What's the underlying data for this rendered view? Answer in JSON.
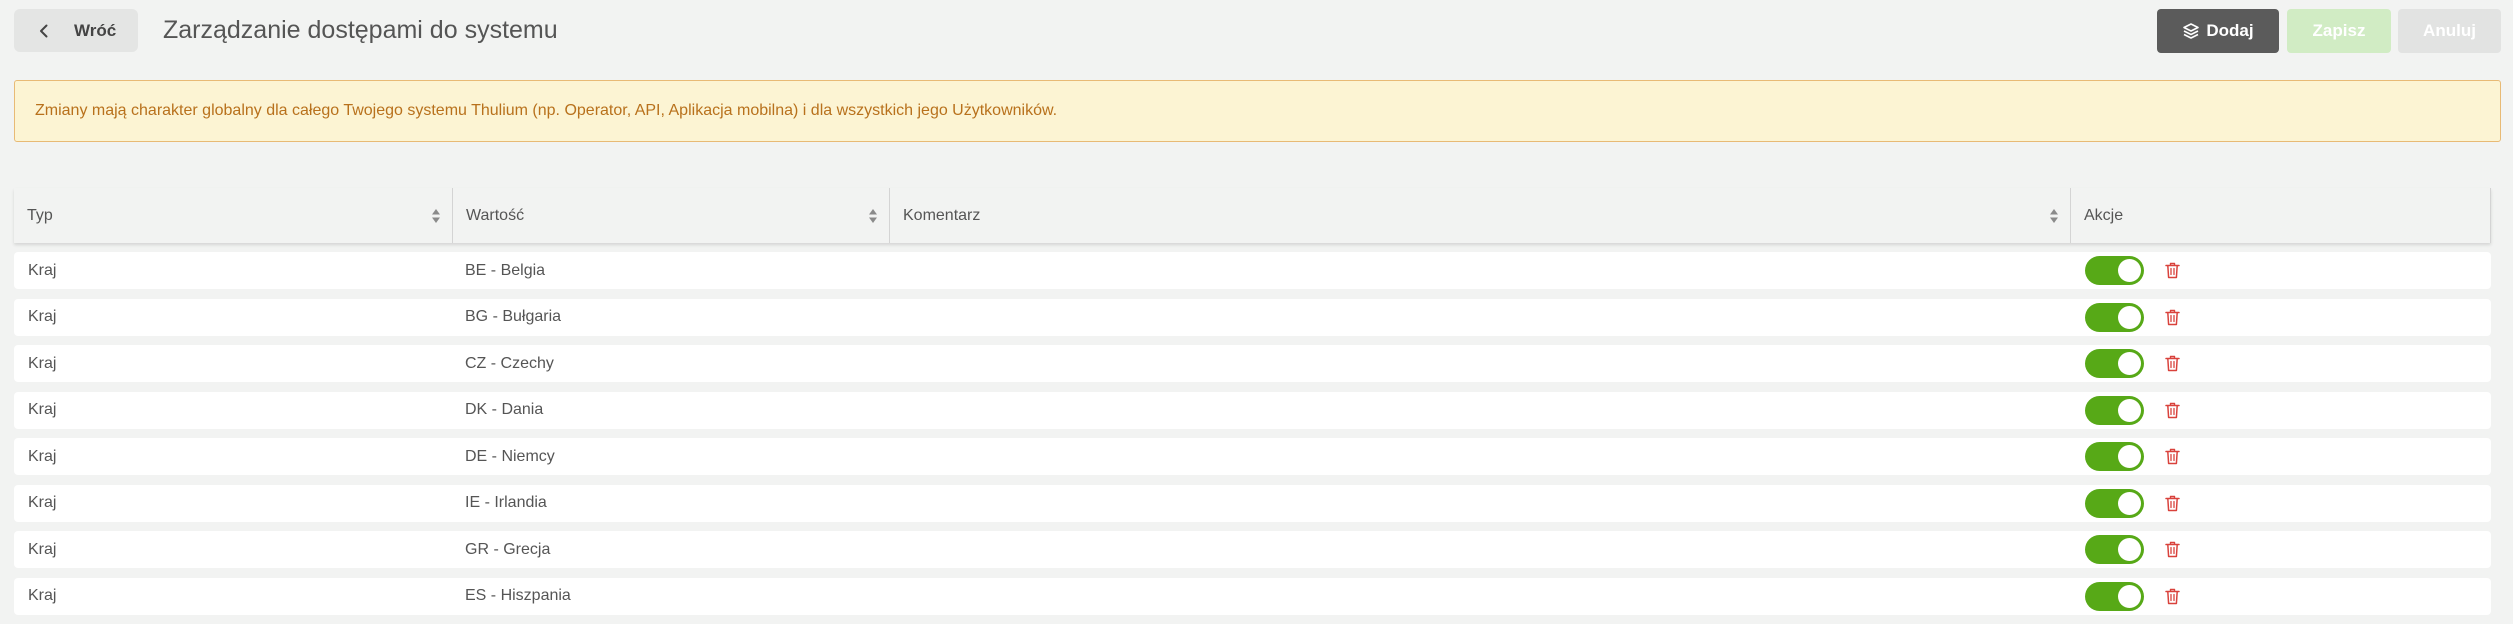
{
  "header": {
    "back_label": "Wróć",
    "title": "Zarządzanie dostępami do systemu",
    "add_label": "Dodaj",
    "save_label": "Zapisz",
    "cancel_label": "Anuluj"
  },
  "notice": {
    "text": "Zmiany mają charakter globalny dla całego Twojego systemu Thulium (np. Operator, API, Aplikacja mobilna) i dla wszystkich jego Użytkowników."
  },
  "table": {
    "columns": [
      "Typ",
      "Wartość",
      "Komentarz",
      "Akcje"
    ],
    "rows": [
      {
        "typ": "Kraj",
        "wartosc": "BE - Belgia",
        "komentarz": "",
        "enabled": true
      },
      {
        "typ": "Kraj",
        "wartosc": "BG - Bułgaria",
        "komentarz": "",
        "enabled": true
      },
      {
        "typ": "Kraj",
        "wartosc": "CZ - Czechy",
        "komentarz": "",
        "enabled": true
      },
      {
        "typ": "Kraj",
        "wartosc": "DK - Dania",
        "komentarz": "",
        "enabled": true
      },
      {
        "typ": "Kraj",
        "wartosc": "DE - Niemcy",
        "komentarz": "",
        "enabled": true
      },
      {
        "typ": "Kraj",
        "wartosc": "IE - Irlandia",
        "komentarz": "",
        "enabled": true
      },
      {
        "typ": "Kraj",
        "wartosc": "GR - Grecja",
        "komentarz": "",
        "enabled": true
      },
      {
        "typ": "Kraj",
        "wartosc": "ES - Hiszpania",
        "komentarz": "",
        "enabled": true
      }
    ]
  },
  "icons": {
    "back": "chevron-left-icon",
    "add": "layers-plus-icon",
    "sort": "sort-icon",
    "delete": "trash-icon"
  },
  "colors": {
    "toggle_on": "#57a917",
    "delete_icon": "#d9423c",
    "notice_text": "#b8711c",
    "notice_bg": "#fcf4d3",
    "add_button": "#5b5b5b",
    "save_button_disabled": "#d1ecc4"
  }
}
